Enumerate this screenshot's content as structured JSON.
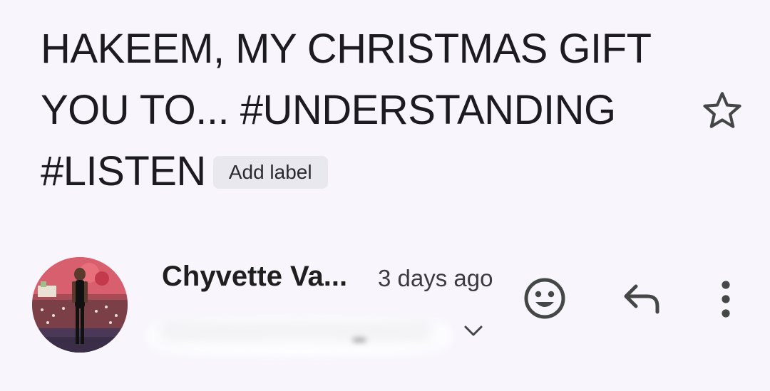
{
  "email": {
    "subject_lines": [
      "HAKEEM, MY CHRISTMAS GIFT",
      "YOU TO... #UNDERSTANDING",
      "#LISTEN"
    ],
    "add_label": "Add label",
    "sender": {
      "name": "Chyvette Va...",
      "time": "3 days ago"
    }
  },
  "icons": {
    "star": "star-outline-icon",
    "expand": "chevron-down-icon",
    "react": "emoji-smile-icon",
    "reply": "reply-icon",
    "more": "more-vert-icon"
  },
  "colors": {
    "background": "#f8f6fc",
    "text": "#1c1b1f",
    "chip": "#e8e8ee",
    "icon": "#444746"
  }
}
